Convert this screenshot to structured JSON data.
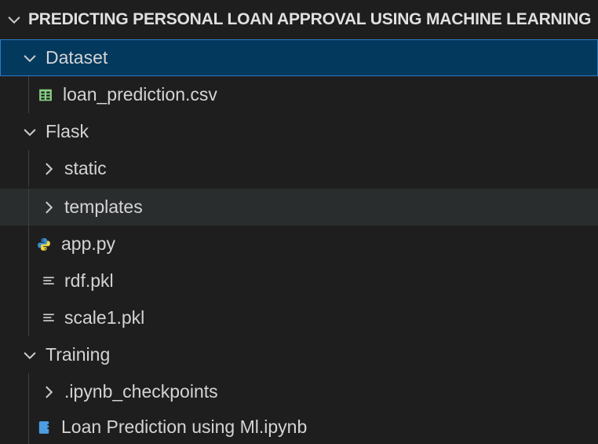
{
  "explorer": {
    "section_title": "PREDICTING PERSONAL LOAN APPROVAL USING MACHINE LEARNING",
    "items": [
      {
        "label": "Dataset",
        "kind": "folder",
        "expanded": true,
        "level": 0,
        "selected": true
      },
      {
        "label": "loan_prediction.csv",
        "kind": "file",
        "icon": "csv-table-icon",
        "level": 1
      },
      {
        "label": "Flask",
        "kind": "folder",
        "expanded": true,
        "level": 0
      },
      {
        "label": "static",
        "kind": "folder",
        "expanded": false,
        "level": 1
      },
      {
        "label": "templates",
        "kind": "folder",
        "expanded": false,
        "level": 1,
        "hover": true
      },
      {
        "label": "app.py",
        "kind": "file",
        "icon": "python-icon",
        "level": 1
      },
      {
        "label": "rdf.pkl",
        "kind": "file",
        "icon": "text-lines-icon",
        "level": 1
      },
      {
        "label": "scale1.pkl",
        "kind": "file",
        "icon": "text-lines-icon",
        "level": 1
      },
      {
        "label": "Training",
        "kind": "folder",
        "expanded": true,
        "level": 0
      },
      {
        "label": ".ipynb_checkpoints",
        "kind": "folder",
        "expanded": false,
        "level": 1
      },
      {
        "label": "Loan Prediction using Ml.ipynb",
        "kind": "file",
        "icon": "notebook-icon",
        "level": 1
      }
    ]
  },
  "colors": {
    "background": "#1e1e1e",
    "selection": "#04395e",
    "selection_border": "#2b79c2",
    "hover": "#2a2d2e",
    "csv_green": "#89d185",
    "python_blue": "#3c8fd1",
    "python_yellow": "#f0d64c",
    "notebook_blue": "#4d9de0"
  }
}
